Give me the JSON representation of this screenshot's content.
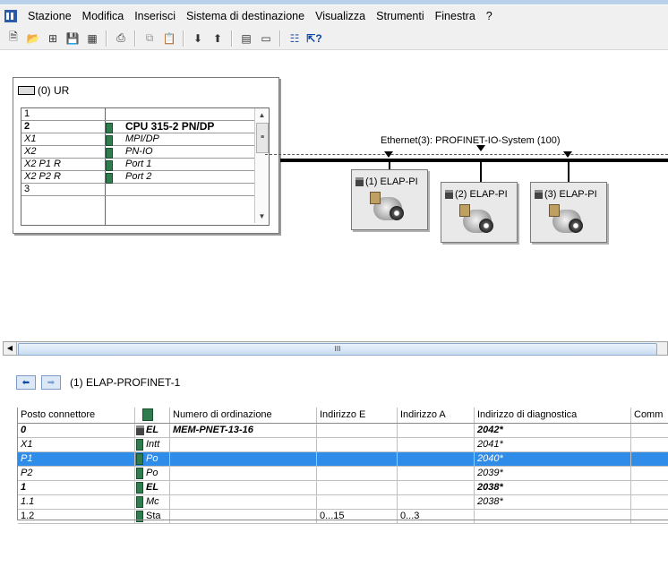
{
  "menubar": {
    "items": [
      "Stazione",
      "Modifica",
      "Inserisci",
      "Sistema di destinazione",
      "Visualizza",
      "Strumenti",
      "Finestra",
      "?"
    ]
  },
  "toolbar": {
    "icons": [
      "new-icon",
      "open-icon",
      "accessible-nodes-icon",
      "save-icon",
      "compile-icon",
      "print-icon",
      "copy-icon",
      "paste-icon",
      "download-icon",
      "upload-icon",
      "catalog-icon",
      "window-icon",
      "network-icon",
      "help-icon"
    ]
  },
  "rack": {
    "title": "(0) UR",
    "rows": [
      {
        "slot": "1",
        "module": "",
        "style": "normal"
      },
      {
        "slot": "2",
        "module": "CPU 315-2 PN/DP",
        "style": "bold"
      },
      {
        "slot": "X1",
        "module": "MPI/DP",
        "style": "italic"
      },
      {
        "slot": "X2",
        "module": "PN-IO",
        "style": "italic"
      },
      {
        "slot": "X2 P1 R",
        "module": "Port 1",
        "style": "italic"
      },
      {
        "slot": "X2 P2 R",
        "module": "Port 2",
        "style": "italic"
      },
      {
        "slot": "3",
        "module": "",
        "style": "normal"
      }
    ]
  },
  "network": {
    "bus_label": "Ethernet(3): PROFINET-IO-System (100)",
    "devices": [
      {
        "label": "(1) ELAP-PI"
      },
      {
        "label": "(2) ELAP-PI"
      },
      {
        "label": "(3) ELAP-PI"
      }
    ]
  },
  "scrollbar": {
    "grip": "III"
  },
  "detail": {
    "title": "(1)  ELAP-PROFINET-1",
    "columns": [
      "Posto connettore",
      "",
      "Numero di ordinazione",
      "Indirizzo E",
      "Indirizzo A",
      "Indirizzo di diagnostica",
      "Comm"
    ],
    "rows": [
      {
        "slot": "0",
        "icon": "pc",
        "module": "EL",
        "order": "MEM-PNET-13-16",
        "in": "",
        "out": "",
        "diag": "2042*",
        "style": "bold"
      },
      {
        "slot": "X1",
        "icon": "mod",
        "module": "Intt",
        "order": "",
        "in": "",
        "out": "",
        "diag": "2041*",
        "style": "italic"
      },
      {
        "slot": "P1",
        "icon": "mod",
        "module": "Po",
        "order": "",
        "in": "",
        "out": "",
        "diag": "2040*",
        "style": "italic",
        "selected": true
      },
      {
        "slot": "P2",
        "icon": "mod",
        "module": "Po",
        "order": "",
        "in": "",
        "out": "",
        "diag": "2039*",
        "style": "italic"
      },
      {
        "slot": "1",
        "icon": "mod",
        "module": "EL",
        "order": "",
        "in": "",
        "out": "",
        "diag": "2038*",
        "style": "bold"
      },
      {
        "slot": "1.1",
        "icon": "mod",
        "module": "Mc",
        "order": "",
        "in": "",
        "out": "",
        "diag": "2038*",
        "style": "italic"
      },
      {
        "slot": "1.2",
        "icon": "mod",
        "module": "Sta",
        "order": "",
        "in": "0...15",
        "out": "0...3",
        "diag": "",
        "style": "normal"
      }
    ]
  },
  "colors": {
    "selection": "#2f8ce8",
    "menubar": "#f0f0f0",
    "bus": "#000000"
  }
}
